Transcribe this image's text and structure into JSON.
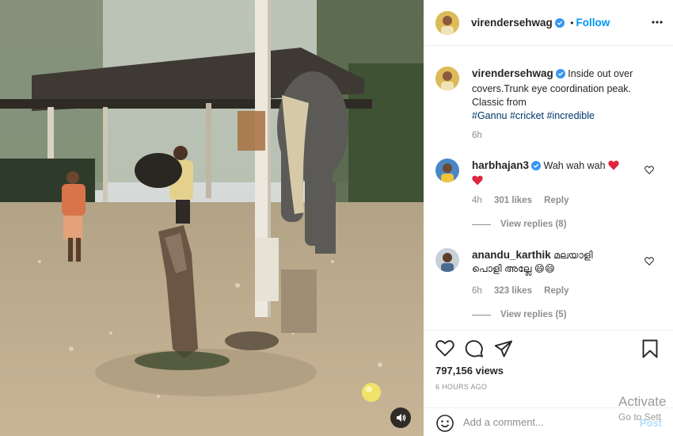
{
  "post": {
    "author": "virendersehwag",
    "follow_label": "Follow",
    "separator": "•"
  },
  "caption": {
    "author": "virendersehwag",
    "text": "Inside out over covers.Trunk eye coordination peak. Classic from",
    "hashtags": [
      "#Gannu",
      "#cricket",
      "#incredible"
    ],
    "time": "6h"
  },
  "comments": [
    {
      "author": "harbhajan3",
      "verified": true,
      "text": "Wah wah wah",
      "time": "4h",
      "likes": "301 likes",
      "reply_label": "Reply",
      "view_replies": "View replies (8)"
    },
    {
      "author": "anandu_karthik",
      "verified": false,
      "text": "മലയാളി പൊളി അല്ലേ 😄😄",
      "time": "6h",
      "likes": "323 likes",
      "reply_label": "Reply",
      "view_replies": "View replies (5)"
    }
  ],
  "stats": {
    "views": "797,156 views",
    "posted": "6 HOURS AGO"
  },
  "comment_box": {
    "placeholder": "Add a comment...",
    "post_label": "Post"
  },
  "watermark": {
    "line1": "Activate",
    "line2": "Go to Sett"
  },
  "icons": {
    "verified": "verified-badge-icon",
    "like": "heart-icon",
    "comment": "comment-icon",
    "share": "paper-plane-icon",
    "save": "bookmark-icon",
    "emoji": "smiley-icon",
    "more": "more-options-icon",
    "mute": "speaker-icon"
  },
  "colors": {
    "accent": "#0095f6",
    "verified": "#3897f0",
    "heart_red": "#ed4956",
    "muted_text": "#8e8e8e",
    "hashtag": "#00376b"
  }
}
